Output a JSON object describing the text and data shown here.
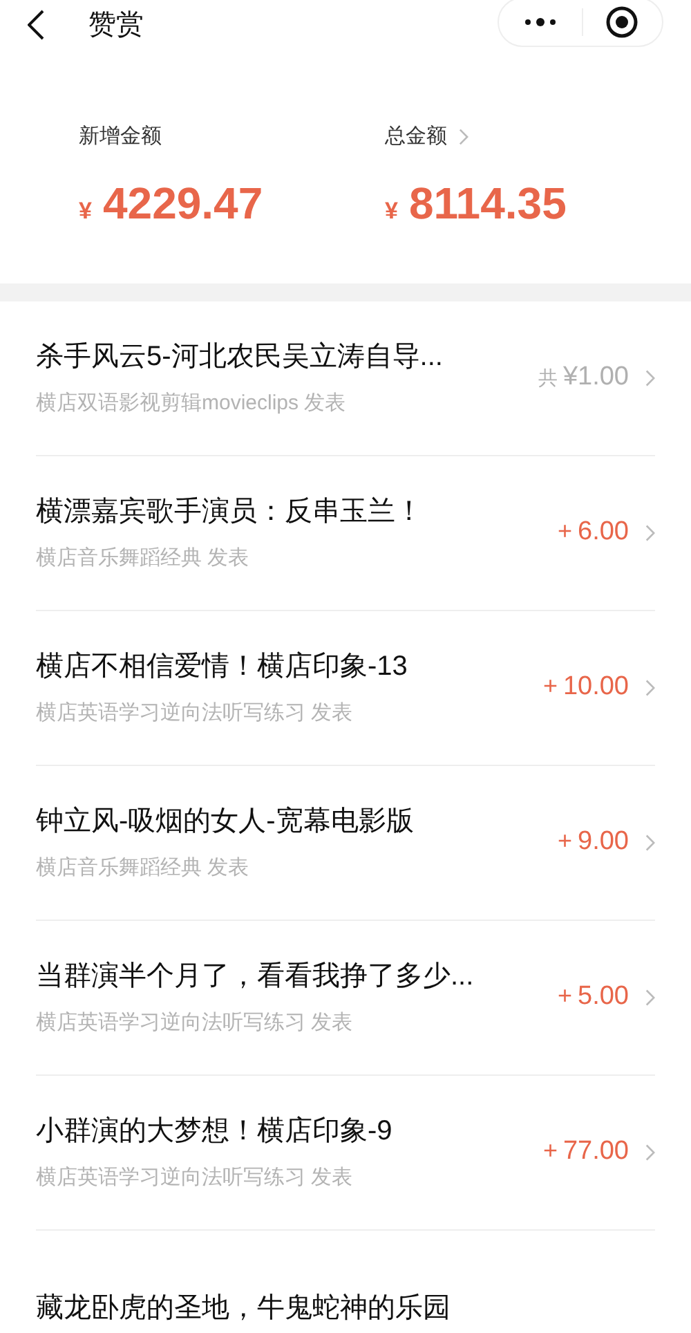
{
  "header": {
    "title": "赞赏"
  },
  "stats": [
    {
      "label": "新增金额",
      "currency": "¥",
      "value": "4229.47",
      "has_arrow": false
    },
    {
      "label": "总金额",
      "currency": "¥",
      "value": "8114.35",
      "has_arrow": true
    }
  ],
  "items": [
    {
      "title": "杀手风云5-河北农民吴立涛自导...",
      "author": "横店双语影视剪辑movieclips 发表",
      "kind": "total",
      "prefix": "共",
      "amount": "¥1.00"
    },
    {
      "title": "横漂嘉宾歌手演员：反串玉兰！",
      "author": "横店音乐舞蹈经典 发表",
      "kind": "plus",
      "prefix": "+",
      "amount": "6.00"
    },
    {
      "title": "横店不相信爱情！横店印象-13",
      "author": "横店英语学习逆向法听写练习 发表",
      "kind": "plus",
      "prefix": "+",
      "amount": "10.00"
    },
    {
      "title": "钟立风-吸烟的女人-宽幕电影版",
      "author": "横店音乐舞蹈经典 发表",
      "kind": "plus",
      "prefix": "+",
      "amount": "9.00"
    },
    {
      "title": "当群演半个月了，看看我挣了多少...",
      "author": "横店英语学习逆向法听写练习 发表",
      "kind": "plus",
      "prefix": "+",
      "amount": "5.00"
    },
    {
      "title": "小群演的大梦想！横店印象-9",
      "author": "横店英语学习逆向法听写练习 发表",
      "kind": "plus",
      "prefix": "+",
      "amount": "77.00"
    },
    {
      "title": "藏龙卧虎的圣地，牛鬼蛇神的乐园"
    }
  ]
}
